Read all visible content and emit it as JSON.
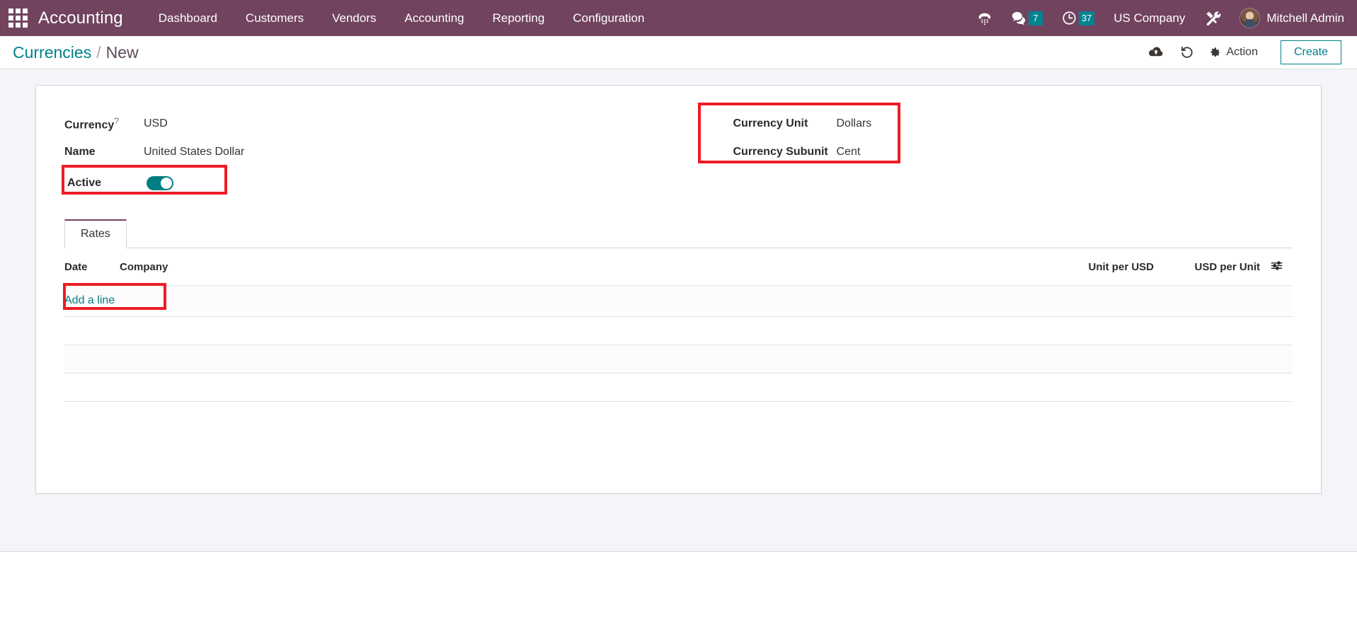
{
  "navbar": {
    "apps_icon": "apps-grid-icon",
    "brand": "Accounting",
    "menu": [
      {
        "label": "Dashboard"
      },
      {
        "label": "Customers"
      },
      {
        "label": "Vendors"
      },
      {
        "label": "Accounting"
      },
      {
        "label": "Reporting"
      },
      {
        "label": "Configuration"
      }
    ],
    "phone_icon": "phone-dialpad-icon",
    "messages": {
      "icon": "chat-bubble-icon",
      "count": "7"
    },
    "activities": {
      "icon": "clock-icon",
      "count": "37"
    },
    "company": "US Company",
    "tools_icon": "tools-icon",
    "user": {
      "name": "Mitchell Admin",
      "avatar": "user-avatar"
    }
  },
  "control_panel": {
    "breadcrumb": {
      "root": "Currencies",
      "separator": "/",
      "current": "New"
    },
    "save_icon": "cloud-upload-icon",
    "discard_icon": "undo-icon",
    "action": {
      "icon": "gear-icon",
      "label": "Action"
    },
    "create_label": "Create"
  },
  "form": {
    "left": [
      {
        "label": "Currency",
        "tooltip": "?",
        "value": "USD"
      },
      {
        "label": "Name",
        "value": "United States Dollar"
      },
      {
        "label": "Active",
        "value": "",
        "type": "toggle",
        "toggle_on": true
      }
    ],
    "right": [
      {
        "label": "Currency Unit",
        "value": "Dollars"
      },
      {
        "label": "Currency Subunit",
        "value": "Cent"
      }
    ]
  },
  "notebook": {
    "tabs": [
      {
        "label": "Rates",
        "active": true
      }
    ]
  },
  "rates_table": {
    "columns": [
      "Date",
      "Company",
      "Unit per USD",
      "USD per Unit"
    ],
    "optional_columns_icon": "column-options-icon",
    "add_line_label": "Add a line",
    "rows": []
  },
  "colors": {
    "navbar_bg": "#71435f",
    "accent_teal": "#00818a",
    "annotation_red": "#ee1b24",
    "page_bg": "#f4f5f8"
  }
}
